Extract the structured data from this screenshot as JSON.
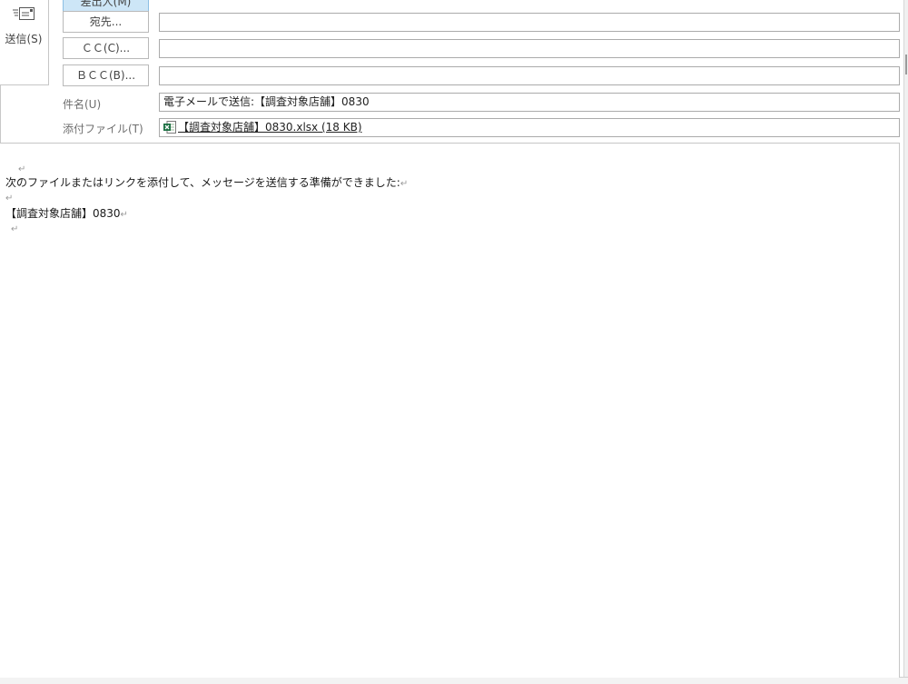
{
  "send": {
    "label": "送信(S)",
    "icon": "send-envelope-icon"
  },
  "header": {
    "from_button": "差出人(M)",
    "to_button": "宛先...",
    "cc_button": "ＣＣ(C)...",
    "bcc_button": "ＢＣＣ(B)...",
    "to_value": "",
    "cc_value": "",
    "bcc_value": "",
    "subject_label": "件名(U)",
    "subject_value": "電子メールで送信:【調査対象店舗】0830",
    "attachment_label": "添付ファイル(T)",
    "attachment_value": "【調査対象店舗】0830.xlsx (18 KB)",
    "attachment_icon": "excel-file-icon"
  },
  "body": {
    "line1": "次のファイルまたはリンクを添付して、メッセージを送信する準備ができました:",
    "line2": "【調査対象店舗】0830",
    "return_mark": "↵"
  },
  "colors": {
    "from_button_bg": "#cde6f7",
    "excel_green": "#1e7145"
  }
}
